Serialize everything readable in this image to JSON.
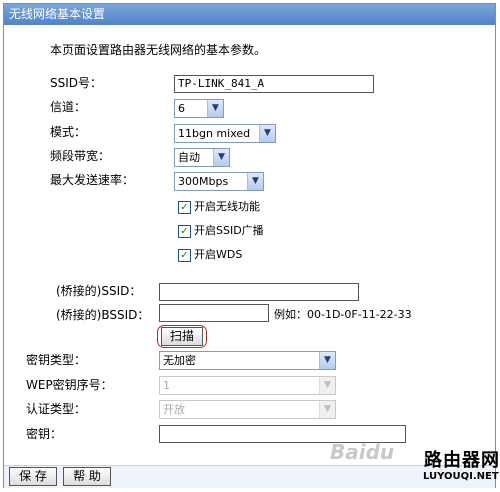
{
  "window": {
    "title": "无线网络基本设置"
  },
  "intro": "本页面设置路由器无线网络的基本参数。",
  "fields": {
    "ssid": {
      "label": "SSID号：",
      "value": "TP-LINK_841_A"
    },
    "channel": {
      "label": "信道：",
      "value": "6"
    },
    "mode": {
      "label": "模式：",
      "value": "11bgn mixed"
    },
    "bandwidth": {
      "label": "频段带宽：",
      "value": "自动"
    },
    "max_rate": {
      "label": "最大发送速率：",
      "value": "300Mbps"
    }
  },
  "checkboxes": [
    {
      "label": "开启无线功能",
      "checked": true
    },
    {
      "label": "开启SSID广播",
      "checked": true
    },
    {
      "label": "开启WDS",
      "checked": true
    }
  ],
  "wds": {
    "ssid_label": "(桥接的)SSID：",
    "ssid_value": "",
    "bssid_label": "(桥接的)BSSID：",
    "bssid_value": "",
    "example": "例如：00-1D-0F-11-22-33",
    "scan_label": "扫描"
  },
  "security": {
    "key_type_label": "密钥类型：",
    "key_type_value": "无加密",
    "wep_index_label": "WEP密钥序号：",
    "wep_index_value": "1",
    "auth_label": "认证类型：",
    "auth_value": "开放",
    "key_label": "密钥：",
    "key_value": ""
  },
  "footer": {
    "save_label": "保 存",
    "help_label": "帮 助"
  },
  "watermark": {
    "baidu": "Baidu",
    "site_cn": "路由器网",
    "site_en": "LUYOUQI.NET"
  },
  "colors": {
    "titlebar": "#4f82c8",
    "scan_highlight": "#b2302a"
  },
  "icons": {
    "dropdown": "chevron-down-icon",
    "checkbox": "checkmark-icon"
  }
}
